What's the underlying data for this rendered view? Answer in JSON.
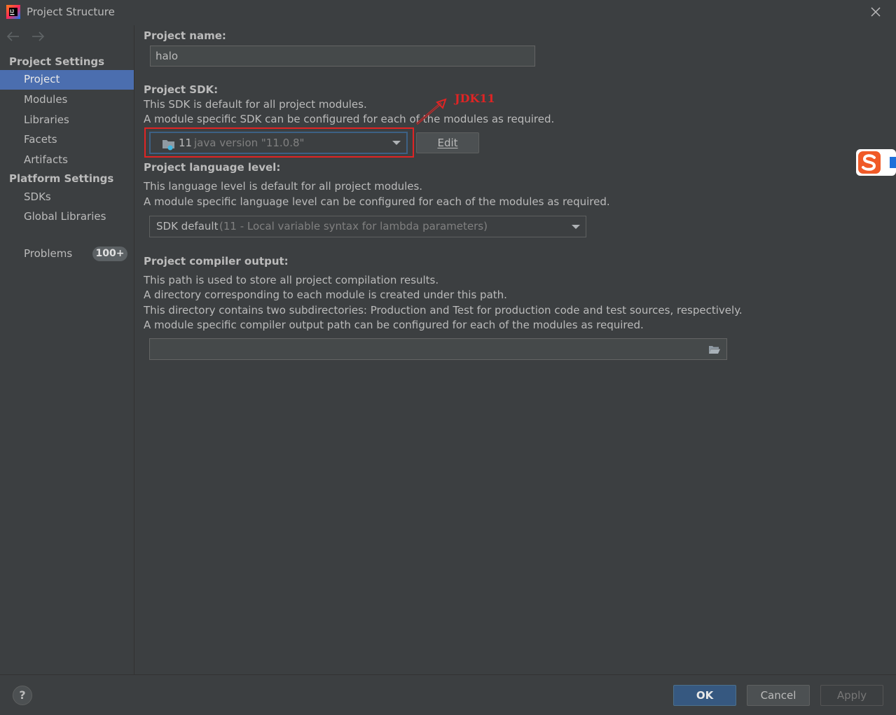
{
  "window": {
    "title": "Project Structure"
  },
  "sidebar": {
    "sections": [
      {
        "header": "Project Settings",
        "items": [
          {
            "label": "Project",
            "selected": true
          },
          {
            "label": "Modules"
          },
          {
            "label": "Libraries"
          },
          {
            "label": "Facets"
          },
          {
            "label": "Artifacts"
          }
        ]
      },
      {
        "header": "Platform Settings",
        "items": [
          {
            "label": "SDKs"
          },
          {
            "label": "Global Libraries"
          }
        ]
      }
    ],
    "problems": {
      "label": "Problems",
      "badge": "100+"
    }
  },
  "main": {
    "project_name": {
      "label": "Project name:",
      "value": "halo"
    },
    "project_sdk": {
      "label": "Project SDK:",
      "desc1": "This SDK is default for all project modules.",
      "desc2": "A module specific SDK can be configured for each of the modules as required.",
      "combo_version": "11",
      "combo_detail": "java version \"11.0.8\"",
      "edit_button": "Edit",
      "annotation": "JDK11"
    },
    "language_level": {
      "label": "Project language level:",
      "desc1": "This language level is default for all project modules.",
      "desc2": "A module specific language level can be configured for each of the modules as required.",
      "combo_value": "SDK default",
      "combo_detail": "(11 - Local variable syntax for lambda parameters)"
    },
    "compiler_output": {
      "label": "Project compiler output:",
      "desc1": "This path is used to store all project compilation results.",
      "desc2": "A directory corresponding to each module is created under this path.",
      "desc3": "This directory contains two subdirectories: Production and Test for production code and test sources, respectively.",
      "desc4": "A module specific compiler output path can be configured for each of the modules as required.",
      "path_value": ""
    }
  },
  "footer": {
    "help": "?",
    "ok": "OK",
    "cancel": "Cancel",
    "apply": "Apply"
  },
  "colors": {
    "background": "#3c3f41",
    "selection": "#4b6eaf",
    "annotation": "#e02424",
    "primary_button": "#365880"
  }
}
